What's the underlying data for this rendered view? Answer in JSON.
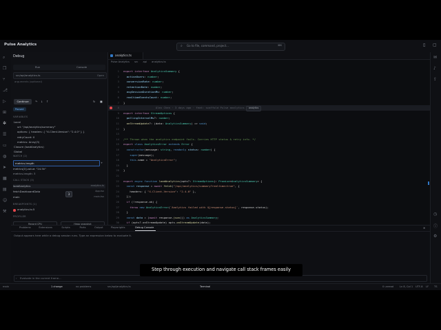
{
  "app": {
    "title": "Pulse Analytics"
  },
  "command_bar": {
    "placeholder": "Go to file, command, project...",
    "shortcut": "⌘K"
  },
  "sidebar": {
    "title": "Debug",
    "tabs": [
      "Run",
      "Console"
    ],
    "file_input": "src/api/analytics.ts",
    "file_action": "Open",
    "args_placeholder": "arguments (optional)",
    "continue_label": "Continue",
    "paused_label": "Paused",
    "variables_header": "VARIABLES",
    "variables": [
      {
        "text": "Local",
        "indent": 0
      },
      {
        "text": "url: \"/api/analytics/summary\"",
        "indent": 1
      },
      {
        "text": "options: { headers: { \"X-Client-Version\": \"2.4.0\" } }",
        "indent": 1
      },
      {
        "text": "retryCount: 0",
        "indent": 1
      },
      {
        "text": "metrics: Array(3)",
        "indent": 1
      },
      {
        "text": "Closure (loadAnalytics)",
        "indent": 0
      },
      {
        "text": "Global",
        "indent": 0
      }
    ],
    "watch_header": "WATCH (2)",
    "watch_input": "metrics.length",
    "watch_items": [
      "metrics[0].value: \"24.5k\"",
      "metrics.length: 3"
    ],
    "tooltip": "3",
    "callstack_header": "CALL STACK (3)",
    "callstack": [
      {
        "fn": "loadAnalytics",
        "loc": "analytics.ts"
      },
      {
        "fn": "fetchDashboardData",
        "loc": "App.tsx"
      },
      {
        "fn": "main",
        "loc": "main.tsx"
      }
    ],
    "breakpoints_header": "BREAKPOINTS (1)",
    "breakpoints": [
      "analytics.ts:5"
    ],
    "profiler_header": "PROFILER",
    "record_cpu": "Record CPU",
    "heap_snapshot": "Heap snapshot"
  },
  "editor": {
    "tab": "analytics.ts",
    "breadcrumb": [
      "Pulse Analytics",
      "src",
      "api",
      "analytics.ts"
    ],
    "badge": "analytics",
    "lines": [
      {
        "n": 1,
        "parts": [
          [
            "k",
            "export "
          ],
          [
            "k",
            "interface "
          ],
          [
            "t",
            "AnalyticsSummary"
          ],
          [
            "d",
            " {"
          ]
        ]
      },
      {
        "n": 2,
        "parts": [
          [
            "p",
            "  activeUsers"
          ],
          [
            "d",
            ": "
          ],
          [
            "t",
            "number"
          ],
          [
            "d",
            ";"
          ]
        ]
      },
      {
        "n": 3,
        "parts": [
          [
            "p",
            "  conversionRate"
          ],
          [
            "d",
            ": "
          ],
          [
            "t",
            "number"
          ],
          [
            "d",
            ";"
          ]
        ]
      },
      {
        "n": 4,
        "parts": [
          [
            "p",
            "  retentionRate"
          ],
          [
            "d",
            ": "
          ],
          [
            "t",
            "number"
          ],
          [
            "d",
            ";"
          ]
        ]
      },
      {
        "n": 5,
        "parts": [
          [
            "p",
            "  avgSessionDurationMs"
          ],
          [
            "d",
            ": "
          ],
          [
            "t",
            "number"
          ],
          [
            "d",
            ";"
          ]
        ]
      },
      {
        "n": 6,
        "parts": [
          [
            "p",
            "  realtimeEventsCount"
          ],
          [
            "d",
            ": "
          ],
          [
            "t",
            "number"
          ],
          [
            "d",
            ";"
          ]
        ]
      },
      {
        "n": 7,
        "parts": [
          [
            "d",
            "}"
          ]
        ]
      },
      {
        "n": 8,
        "hl": true,
        "bp": true,
        "parts": [
          [
            "blame",
            "                    Alex Chen · 3 days ago · feat: scaffold Pulse analytics dashboard"
          ]
        ]
      },
      {
        "n": 9,
        "parts": [
          [
            "k",
            "export "
          ],
          [
            "k",
            "interface "
          ],
          [
            "t",
            "StreamOptions"
          ],
          [
            "d",
            " {"
          ]
        ]
      },
      {
        "n": 10,
        "parts": [
          [
            "p",
            "  pollingIntervalMs"
          ],
          [
            "d",
            "?: "
          ],
          [
            "t",
            "number"
          ],
          [
            "d",
            ";"
          ]
        ]
      },
      {
        "n": 11,
        "parts": [
          [
            "f",
            "  onStreamUpdate"
          ],
          [
            "d",
            "?: (data: "
          ],
          [
            "t",
            "AnalyticsSummary"
          ],
          [
            "d",
            ") => "
          ],
          [
            "b",
            "void"
          ],
          [
            "d",
            ";"
          ]
        ]
      },
      {
        "n": 12,
        "parts": [
          [
            "d",
            "}"
          ]
        ]
      },
      {
        "n": 13,
        "parts": [
          [
            "d",
            ""
          ]
        ]
      },
      {
        "n": 14,
        "parts": [
          [
            "c",
            "/** Thrown when the analytics endpoint fails. Carries HTTP status & retry info. */"
          ]
        ]
      },
      {
        "n": 15,
        "parts": [
          [
            "k",
            "export "
          ],
          [
            "b",
            "class "
          ],
          [
            "t",
            "AnalyticsError "
          ],
          [
            "b",
            "extends "
          ],
          [
            "t",
            "Error"
          ],
          [
            "d",
            " {"
          ]
        ]
      },
      {
        "n": 16,
        "parts": [
          [
            "b",
            "  constructor"
          ],
          [
            "d",
            "(message: "
          ],
          [
            "t",
            "string"
          ],
          [
            "d",
            ", "
          ],
          [
            "b",
            "readonly "
          ],
          [
            "p",
            "status"
          ],
          [
            "d",
            ": "
          ],
          [
            "t",
            "number"
          ],
          [
            "d",
            ") {"
          ]
        ]
      },
      {
        "n": 17,
        "parts": [
          [
            "b",
            "    super"
          ],
          [
            "d",
            "(message);"
          ]
        ]
      },
      {
        "n": 18,
        "parts": [
          [
            "b",
            "    this"
          ],
          [
            "d",
            ".name = "
          ],
          [
            "s",
            "\"AnalyticsError\""
          ],
          [
            "d",
            ";"
          ]
        ]
      },
      {
        "n": 19,
        "parts": [
          [
            "d",
            "  }"
          ]
        ]
      },
      {
        "n": 20,
        "parts": [
          [
            "d",
            "}"
          ]
        ]
      },
      {
        "n": 21,
        "parts": [
          [
            "d",
            ""
          ]
        ]
      },
      {
        "n": 22,
        "parts": [
          [
            "k",
            "export "
          ],
          [
            "b",
            "async "
          ],
          [
            "b",
            "function "
          ],
          [
            "f",
            "loadAnalytics"
          ],
          [
            "d",
            "(opts?: "
          ],
          [
            "t",
            "StreamOptions"
          ],
          [
            "d",
            "): "
          ],
          [
            "t",
            "Promise"
          ],
          [
            "d",
            "<"
          ],
          [
            "t",
            "AnalyticsSummary"
          ],
          [
            "d",
            "> {"
          ]
        ]
      },
      {
        "n": 23,
        "parts": [
          [
            "b",
            "  const "
          ],
          [
            "p",
            "response"
          ],
          [
            "d",
            " = "
          ],
          [
            "k",
            "await "
          ],
          [
            "f",
            "fetch"
          ],
          [
            "d",
            "("
          ],
          [
            "s",
            "\"/api/analytics/summary?realtime=true\""
          ],
          [
            "d",
            ", {"
          ]
        ]
      },
      {
        "n": 24,
        "parts": [
          [
            "d",
            "    headers: { "
          ],
          [
            "s",
            "\"X-Client-Version\""
          ],
          [
            "d",
            ": "
          ],
          [
            "s",
            "\"2.4.0\""
          ],
          [
            "d",
            " },"
          ]
        ]
      },
      {
        "n": 25,
        "parts": [
          [
            "d",
            "  });"
          ]
        ]
      },
      {
        "n": 26,
        "parts": [
          [
            "k",
            "  if "
          ],
          [
            "d",
            "(!response.ok) {"
          ]
        ]
      },
      {
        "n": 27,
        "parts": [
          [
            "k",
            "    throw "
          ],
          [
            "b",
            "new "
          ],
          [
            "t",
            "AnalyticsError"
          ],
          [
            "d",
            "("
          ],
          [
            "s",
            "`Analytics failed with ${response.status}`"
          ],
          [
            "d",
            ", response.status);"
          ]
        ]
      },
      {
        "n": 28,
        "parts": [
          [
            "d",
            "  }"
          ]
        ]
      },
      {
        "n": 29,
        "parts": [
          [
            "b",
            "  const "
          ],
          [
            "p",
            "data"
          ],
          [
            "d",
            " = ("
          ],
          [
            "k",
            "await "
          ],
          [
            "d",
            "response."
          ],
          [
            "f",
            "json"
          ],
          [
            "d",
            "()) "
          ],
          [
            "b",
            "as "
          ],
          [
            "t",
            "AnalyticsSummary"
          ],
          [
            "d",
            ";"
          ]
        ]
      },
      {
        "n": 30,
        "parts": [
          [
            "k",
            "  if "
          ],
          [
            "d",
            "(opts?.onStreamUpdate) opts."
          ],
          [
            "f",
            "onStreamUpdate"
          ],
          [
            "d",
            "(data);"
          ]
        ]
      },
      {
        "n": 31,
        "parts": [
          [
            "k",
            "  return "
          ],
          [
            "d",
            "data;"
          ]
        ]
      }
    ]
  },
  "panel": {
    "tabs": [
      "Problems",
      "Extensions",
      "Scripts",
      "Ports",
      "Output",
      "Playwrights",
      "Debug Console"
    ],
    "active_tab": "Debug Console",
    "message": "Output appears here while a debug session runs. Type an expression below to evaluate it.",
    "input_placeholder": "Evaluate in the current frame..."
  },
  "caption": "Step through execution and navigate call stack frames easily",
  "status": {
    "left": [
      "main",
      "1 change",
      "no problems",
      "src/api/analytics.ts"
    ],
    "terminal": "Terminal",
    "right": [
      "0 unread",
      "Ln 8, Col 1",
      "UTF-8",
      "LF",
      "TS"
    ]
  }
}
